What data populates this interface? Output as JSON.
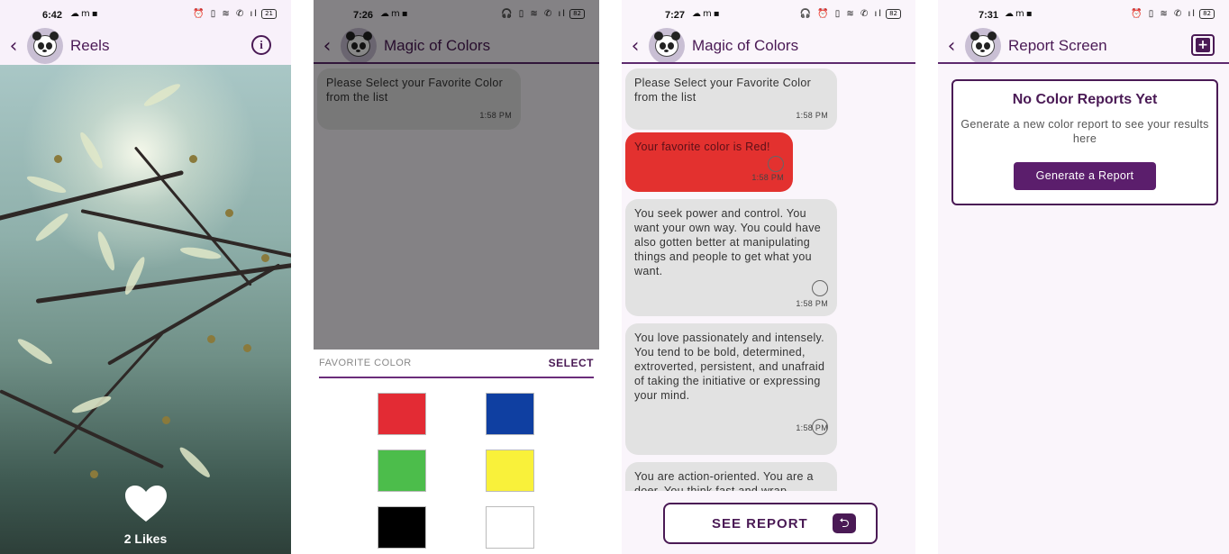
{
  "colors": {
    "accent": "#4a1a55",
    "bubble_gray": "#e2e2e2",
    "bubble_red": "#e3312f"
  },
  "reels_screen": {
    "status_time": "6:42",
    "status_battery": "21",
    "title": "Reels",
    "likes_label": "2 Likes"
  },
  "select_screen": {
    "status_time": "7:26",
    "status_battery": "82",
    "title": "Magic of Colors",
    "prompt_message": "Please Select your Favorite Color from the list",
    "prompt_time": "1:58 PM",
    "sheet_label": "FAVORITE COLOR",
    "select_label": "SELECT",
    "swatches": [
      "#e32b34",
      "#0f3fa1",
      "#4cbd4b",
      "#f9f13a",
      "#000000",
      "#ffffff"
    ]
  },
  "chat_screen": {
    "status_time": "7:27",
    "status_battery": "82",
    "title": "Magic of Colors",
    "messages": [
      {
        "text": "Please Select your Favorite Color from the list",
        "time": "1:58 PM"
      },
      {
        "text": "Your favorite color is Red!",
        "time": "1:58 PM"
      },
      {
        "text": "You seek power and control. You want your own way. You could have also gotten better at manipulating things and people to get what you want.",
        "time": "1:58 PM"
      },
      {
        "text": "You love passionately and intensely. You tend to be bold, determined, extroverted, persistent, and unafraid of taking the initiative or expressing your mind.",
        "time": "1:58 PM"
      },
      {
        "text": "You are action-oriented. You are a doer. You think fast and wrap",
        "time": ""
      }
    ],
    "see_report_label": "SEE REPORT"
  },
  "report_screen": {
    "status_time": "7:31",
    "status_battery": "82",
    "title": "Report Screen",
    "empty_title": "No Color Reports Yet",
    "empty_text": "Generate a new color report to see your results here",
    "generate_label": "Generate a Report"
  }
}
